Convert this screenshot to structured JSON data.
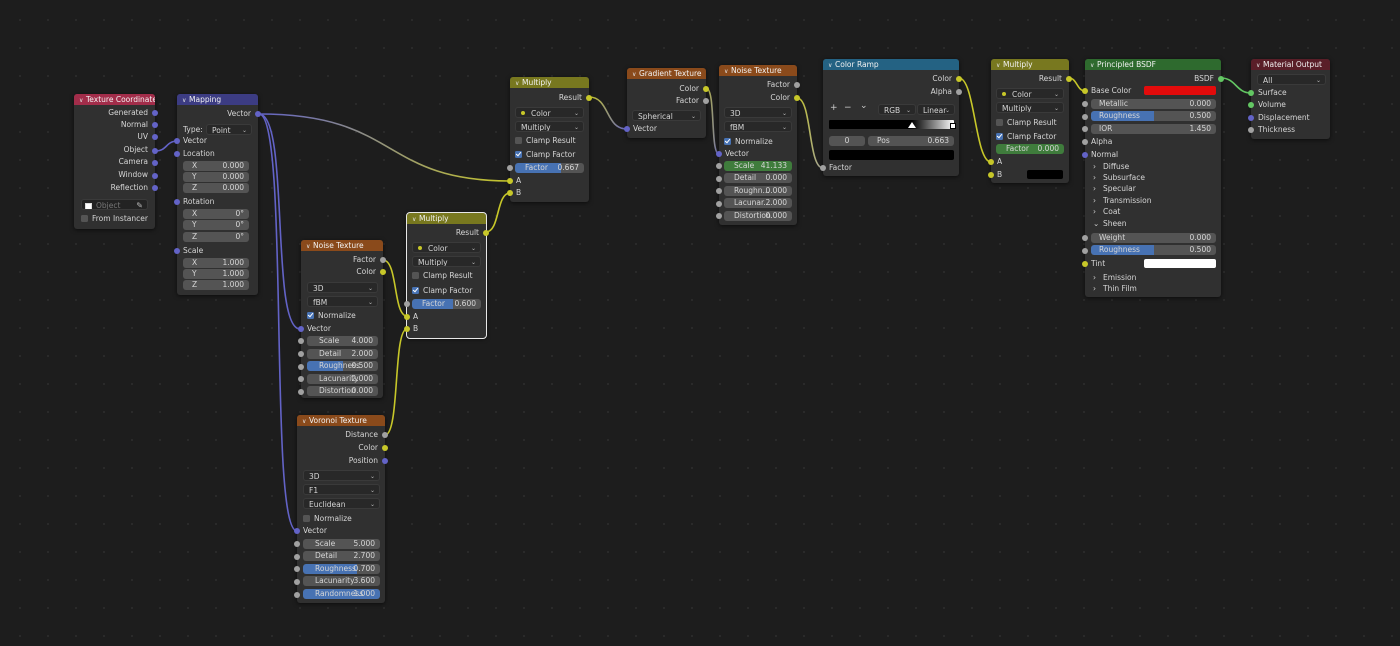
{
  "colors": {
    "vector": "#6363c7",
    "color": "#c7c729",
    "float": "#a1a1a1",
    "shader": "#63c763",
    "hdr_input": "#a22d4a",
    "hdr_vector": "#3c3c83",
    "hdr_texture": "#8a4a1b",
    "hdr_converter": "#78781f",
    "hdr_ramp": "#246283",
    "hdr_shader": "#2e6a2e",
    "hdr_output": "#5a1e28"
  },
  "tex_coord": {
    "title": "Texture Coordinate",
    "outputs": [
      "Generated",
      "Normal",
      "UV",
      "Object",
      "Camera",
      "Window",
      "Reflection"
    ],
    "object_placeholder": "Object",
    "from_instancer": "From Instancer",
    "eyedropper_icon": "eyedropper-icon"
  },
  "mapping": {
    "title": "Mapping",
    "out_vector": "Vector",
    "type_label": "Type:",
    "type_value": "Point",
    "in_vector": "Vector",
    "location": "Location",
    "rotation": "Rotation",
    "scale": "Scale",
    "loc": [
      {
        "k": "X",
        "v": "0.000"
      },
      {
        "k": "Y",
        "v": "0.000"
      },
      {
        "k": "Z",
        "v": "0.000"
      }
    ],
    "rot": [
      {
        "k": "X",
        "v": "0°"
      },
      {
        "k": "Y",
        "v": "0°"
      },
      {
        "k": "Z",
        "v": "0°"
      }
    ],
    "scl": [
      {
        "k": "X",
        "v": "1.000"
      },
      {
        "k": "Y",
        "v": "1.000"
      },
      {
        "k": "Z",
        "v": "1.000"
      }
    ]
  },
  "noise1": {
    "title": "Noise Texture",
    "out_factor": "Factor",
    "out_color": "Color",
    "dim": "3D",
    "type": "fBM",
    "normalize": "Normalize",
    "vector": "Vector",
    "fields": [
      {
        "k": "Scale",
        "v": "4.000"
      },
      {
        "k": "Detail",
        "v": "2.000"
      },
      {
        "k": "Roughness",
        "v": "0.500"
      },
      {
        "k": "Lacunarity",
        "v": "2.000"
      },
      {
        "k": "Distortion",
        "v": "0.000"
      }
    ],
    "roughness_level": 0.5
  },
  "voronoi": {
    "title": "Voronoi Texture",
    "outputs": [
      "Distance",
      "Color",
      "Position"
    ],
    "dim": "3D",
    "feature": "F1",
    "metric": "Euclidean",
    "normalize": "Normalize",
    "vector": "Vector",
    "fields": [
      {
        "k": "Scale",
        "v": "5.000"
      },
      {
        "k": "Detail",
        "v": "2.700"
      },
      {
        "k": "Roughness",
        "v": "0.700"
      },
      {
        "k": "Lacunarity",
        "v": "3.600"
      },
      {
        "k": "Randomness",
        "v": "1.000"
      }
    ],
    "roughness_level": 0.7,
    "randomness_level": 1.0
  },
  "mult1": {
    "title": "Multiply",
    "out_result": "Result",
    "type": "Color",
    "blend": "Multiply",
    "clamp_result": "Clamp Result",
    "clamp_factor": "Clamp Factor",
    "factor_label": "Factor",
    "factor_value": "0.600",
    "factor_level": 0.6,
    "in_a": "A",
    "in_b": "B"
  },
  "mult2": {
    "title": "Multiply",
    "out_result": "Result",
    "type": "Color",
    "blend": "Multiply",
    "clamp_result": "Clamp Result",
    "clamp_factor": "Clamp Factor",
    "factor_label": "Factor",
    "factor_value": "0.667",
    "factor_level": 0.667,
    "in_a": "A",
    "in_b": "B"
  },
  "gradient": {
    "title": "Gradient Texture",
    "out_color": "Color",
    "out_factor": "Factor",
    "type": "Spherical",
    "vector": "Vector"
  },
  "noise2": {
    "title": "Noise Texture",
    "out_factor": "Factor",
    "out_color": "Color",
    "dim": "3D",
    "type": "fBM",
    "normalize": "Normalize",
    "vector": "Vector",
    "fields": [
      {
        "k": "Scale",
        "v": "41.133"
      },
      {
        "k": "Detail",
        "v": "0.000"
      },
      {
        "k": "Roughn...",
        "v": "0.000"
      },
      {
        "k": "Lacunar...",
        "v": "2.000"
      },
      {
        "k": "Distortion",
        "v": "0.000"
      }
    ]
  },
  "ramp": {
    "title": "Color Ramp",
    "out_color": "Color",
    "out_alpha": "Alpha",
    "add": "+",
    "remove": "−",
    "menu": "⌄",
    "mode": "RGB",
    "interp": "Linear",
    "index": "0",
    "pos_label": "Pos",
    "pos_value": "0.663",
    "in_factor": "Factor",
    "pos_level": 0.663
  },
  "mult3": {
    "title": "Multiply",
    "out_result": "Result",
    "type": "Color",
    "blend": "Multiply",
    "clamp_result": "Clamp Result",
    "clamp_factor": "Clamp Factor",
    "factor_label": "Factor",
    "factor_value": "0.000",
    "in_a": "A",
    "in_b": "B"
  },
  "bsdf": {
    "title": "Principled BSDF",
    "out_bsdf": "BSDF",
    "base_color": "Base Color",
    "base_color_hex": "#e30b0b",
    "tint_hex": "#ffffff",
    "fields": [
      {
        "k": "Metallic",
        "v": "0.000"
      },
      {
        "k": "Roughness",
        "v": "0.500"
      },
      {
        "k": "IOR",
        "v": "1.450"
      }
    ],
    "roughness_level": 0.5,
    "alpha": "Alpha",
    "normal": "Normal",
    "panels": [
      "Diffuse",
      "Subsurface",
      "Specular",
      "Transmission",
      "Coat"
    ],
    "sheen": "Sheen",
    "sheen_weight_k": "Weight",
    "sheen_weight_v": "0.000",
    "sheen_rough_k": "Roughness",
    "sheen_rough_v": "0.500",
    "tint": "Tint",
    "panels2": [
      "Emission",
      "Thin Film"
    ]
  },
  "output": {
    "title": "Material Output",
    "target": "All",
    "inputs": [
      "Surface",
      "Volume",
      "Displacement",
      "Thickness"
    ]
  }
}
